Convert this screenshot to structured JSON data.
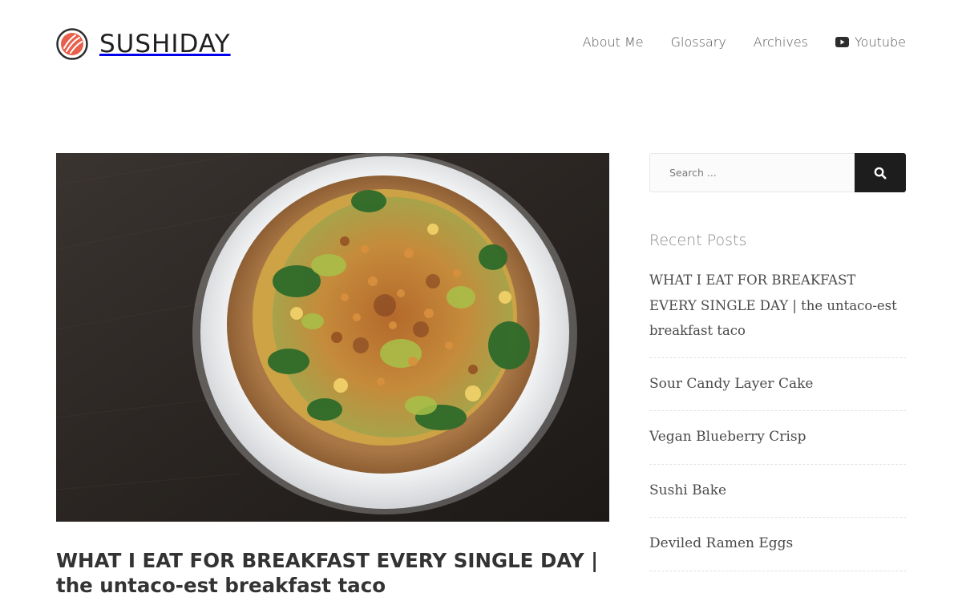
{
  "site": {
    "name": "SUSHIDAY",
    "logo_icon": "sushi-roll-logo-icon",
    "accent_color": "#e8604c"
  },
  "nav": {
    "items": [
      {
        "label": "About Me"
      },
      {
        "label": "Glossary"
      },
      {
        "label": "Archives"
      },
      {
        "label": "Youtube",
        "icon": "youtube-icon"
      }
    ]
  },
  "post": {
    "title": "WHAT I EAT FOR BREAKFAST EVERY SINGLE DAY | the untaco-est breakfast taco",
    "image": "breakfast-taco-photo"
  },
  "sidebar": {
    "search": {
      "placeholder": "Search ...",
      "button_icon": "search-icon"
    },
    "recent_heading": "Recent Posts",
    "recent_posts": [
      {
        "title": "WHAT I EAT FOR BREAKFAST EVERY SINGLE DAY | the untaco-est breakfast taco"
      },
      {
        "title": "Sour Candy Layer Cake"
      },
      {
        "title": "Vegan Blueberry Crisp"
      },
      {
        "title": "Sushi Bake"
      },
      {
        "title": "Deviled Ramen Eggs"
      }
    ]
  }
}
